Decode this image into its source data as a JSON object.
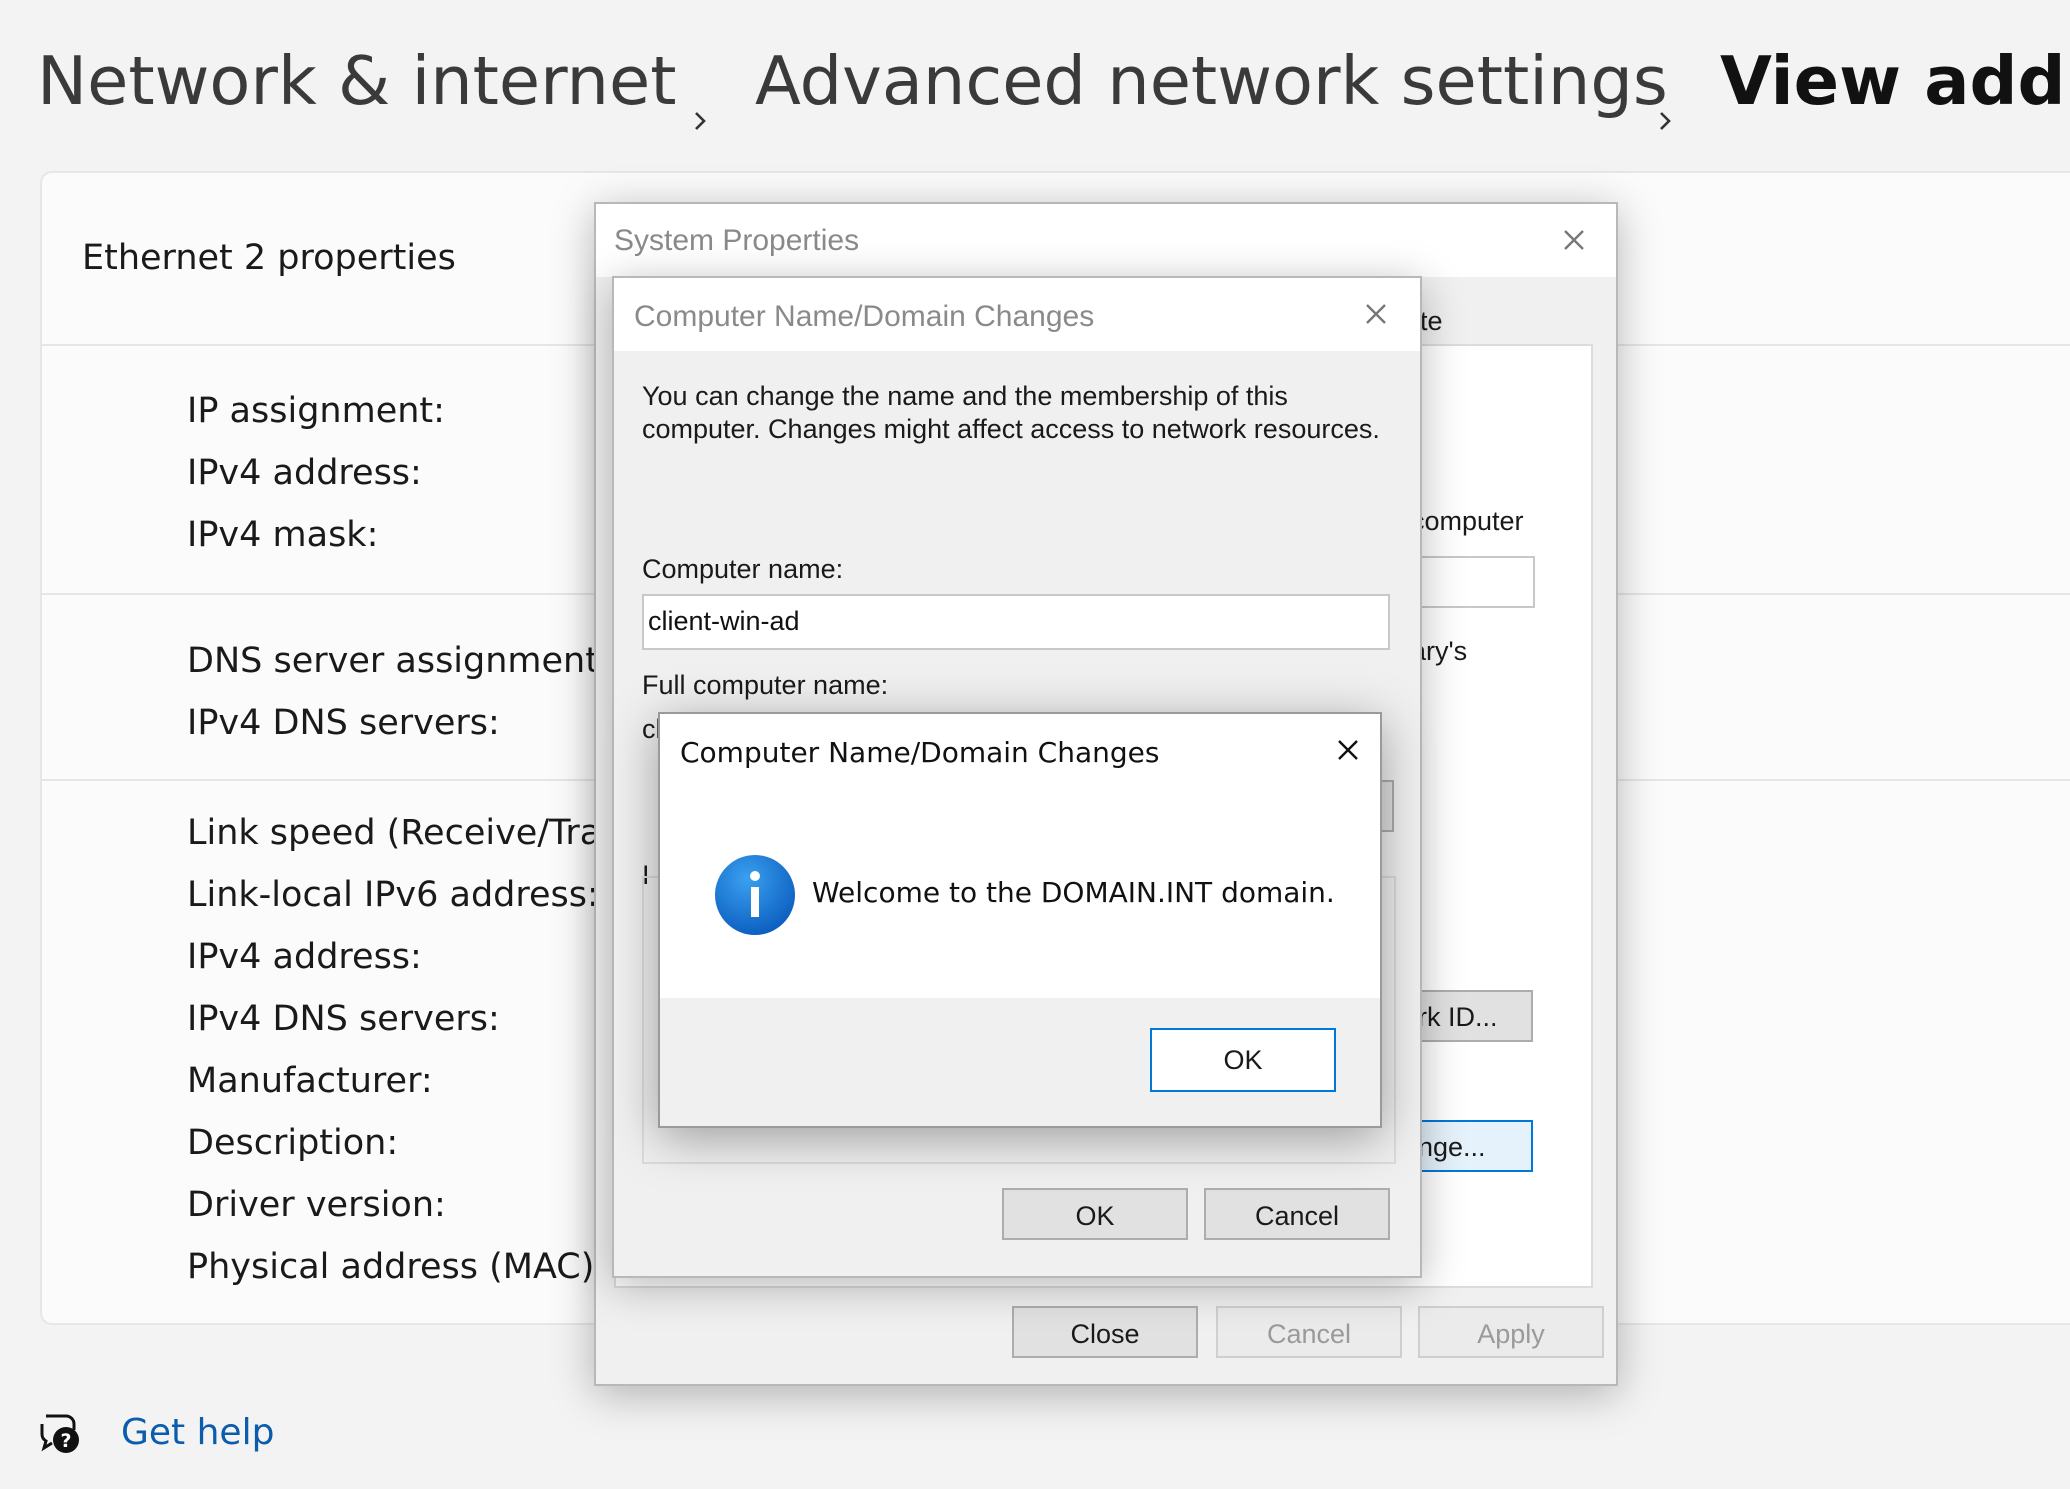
{
  "breadcrumb": {
    "items": [
      "Network & internet",
      "Advanced network settings"
    ],
    "current": "View additi"
  },
  "card": {
    "title": "Ethernet 2 properties",
    "group1": [
      "IP assignment:",
      "IPv4 address:",
      "IPv4 mask:"
    ],
    "group2": [
      "DNS server assignment:",
      "IPv4 DNS servers:"
    ],
    "group3": [
      "Link speed (Receive/Transn",
      "Link-local IPv6 address:",
      "IPv4 address:",
      "IPv4 DNS servers:",
      "Manufacturer:",
      "Description:",
      "Driver version:",
      "Physical address (MAC):"
    ]
  },
  "help": {
    "label": "Get help"
  },
  "system_properties": {
    "title": "System Properties",
    "peek_tab": "te",
    "peek_computer": "computer",
    "peek_arys": "ary's",
    "peek_network_id": "rk ID...",
    "peek_change": "nge...",
    "buttons": {
      "close": "Close",
      "cancel": "Cancel",
      "apply": "Apply"
    }
  },
  "name_changes": {
    "title": "Computer Name/Domain Changes",
    "description": "You can change the name and the membership of this computer. Changes might affect access to network resources.",
    "computer_name_label": "Computer name:",
    "computer_name_value": "client-win-ad",
    "full_name_label": "Full computer name:",
    "full_name_peek": "cl",
    "member_peek": "I",
    "buttons": {
      "ok": "OK",
      "cancel": "Cancel"
    }
  },
  "message_box": {
    "title": "Computer Name/Domain Changes",
    "message": "Welcome to the DOMAIN.INT domain.",
    "icon": "info-icon",
    "ok_label": "OK"
  },
  "colors": {
    "accent": "#0078d7",
    "link": "#0b5cad",
    "info": "#1565c0"
  }
}
